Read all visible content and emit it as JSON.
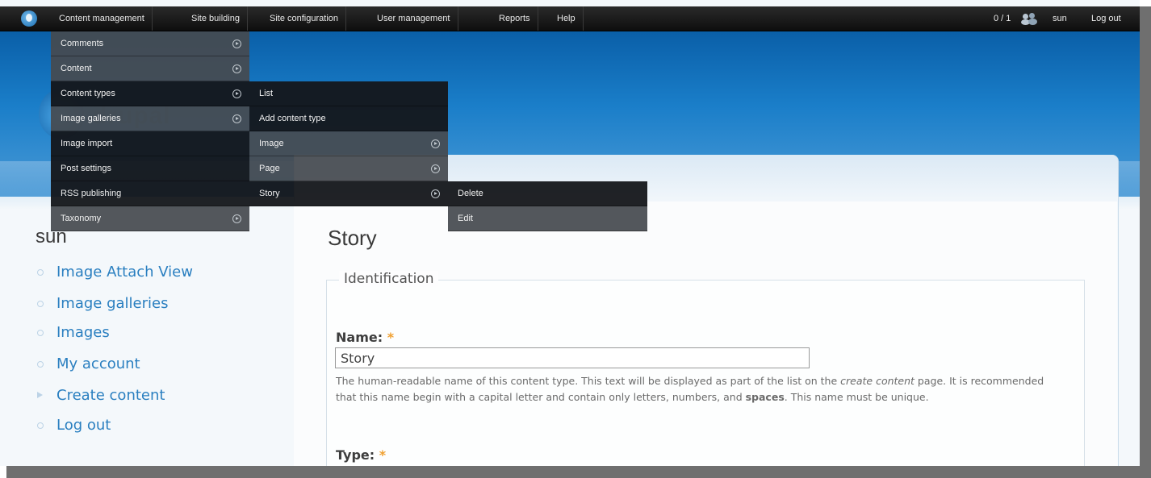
{
  "topbar": {
    "menu": [
      "Content management",
      "Site building",
      "Site configuration",
      "User management",
      "Reports",
      "Help"
    ],
    "counter": "0 / 1",
    "username": "sun",
    "logout": "Log out"
  },
  "dropdown_level1": [
    "Comments",
    "Content",
    "Content types",
    "Image galleries",
    "Image import",
    "Post settings",
    "RSS publishing",
    "Taxonomy"
  ],
  "dropdown_level2": [
    "List",
    "Add content type",
    "Image",
    "Page",
    "Story"
  ],
  "dropdown_level3": [
    "Delete",
    "Edit"
  ],
  "site_name": "drupal",
  "sidebar": {
    "title": "sun",
    "items": [
      "Image Attach View",
      "Image galleries",
      "Images",
      "My account",
      "Create content",
      "Log out"
    ]
  },
  "page": {
    "title": "Story",
    "fieldset_legend": "Identification",
    "name_label": "Name:",
    "name_value": "Story",
    "name_desc_pre": "The human-readable name of this content type. This text will be displayed as part of the list on the ",
    "name_desc_em": "create content",
    "name_desc_mid": " page. It is recommended that this name begin with a capital letter and contain only letters, numbers, and ",
    "name_desc_strong": "spaces",
    "name_desc_post": ". This name must be unique.",
    "type_label": "Type:",
    "required_mark": "*"
  },
  "colors": {
    "header_blue": "#0a5fa8",
    "link_blue": "#2a7fc0",
    "required_orange": "#f0a030",
    "menu_dark": "#141619"
  }
}
